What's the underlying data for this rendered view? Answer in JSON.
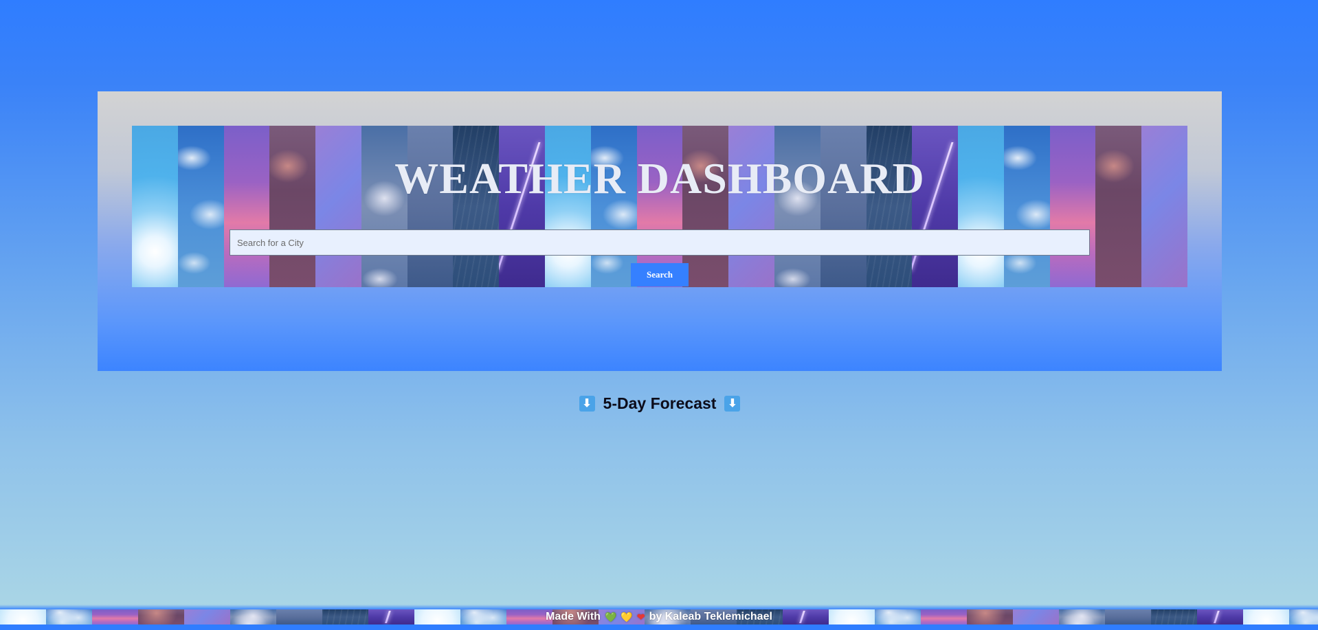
{
  "header": {
    "title": "WEATHER DASHBOARD"
  },
  "search": {
    "placeholder": "Search for a City",
    "button_label": "Search"
  },
  "forecast": {
    "heading": "5-Day Forecast",
    "arrow_glyph": "⬇"
  },
  "footer": {
    "made_with": "Made With",
    "by_line": "by Kaleab Teklemichael",
    "hearts": [
      {
        "icon": "green-heart-icon",
        "glyph": "💚",
        "color": "#4caf50"
      },
      {
        "icon": "yellow-heart-icon",
        "glyph": "💛",
        "color": "#f2c230"
      },
      {
        "icon": "red-heart-icon",
        "glyph": "❤",
        "color": "#e53935"
      }
    ]
  },
  "colors": {
    "page_top": "#2f7dff",
    "page_bottom": "#a9d5e6",
    "accent": "#3580ff",
    "title_text": "#e8ecf6"
  }
}
